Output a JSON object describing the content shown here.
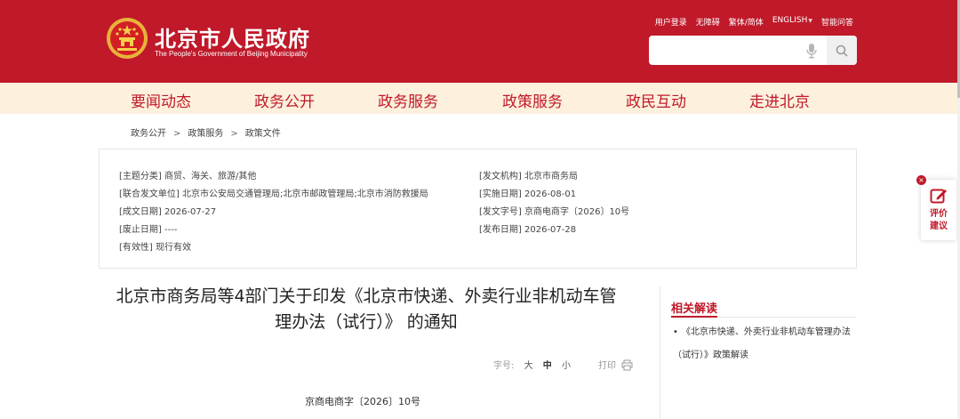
{
  "header": {
    "title": "北京市人民政府",
    "subtitle": "The People's Government of Beijing Municipality",
    "top_links": [
      "用户登录",
      "无障碍",
      "繁体/简体",
      "ENGLISH",
      "智能问答"
    ],
    "search": {
      "value": "",
      "placeholder": ""
    }
  },
  "nav": {
    "items": [
      "要闻动态",
      "政务公开",
      "政务服务",
      "政策服务",
      "政民互动",
      "走进北京"
    ]
  },
  "breadcrumb": [
    "政务公开",
    "政策服务",
    "政策文件"
  ],
  "info": {
    "left": [
      {
        "label": "[主题分类]",
        "value": "商贸、海关、旅游/其他"
      },
      {
        "label": "[联合发文单位]",
        "value": "北京市公安局交通管理局;北京市邮政管理局;北京市消防救援局"
      },
      {
        "label": "[成文日期]",
        "value": "2026-07-27"
      },
      {
        "label": "[废止日期]",
        "value": "----"
      },
      {
        "label": "[有效性]",
        "value": "现行有效"
      }
    ],
    "right": [
      {
        "label": "[发文机构]",
        "value": "北京市商务局"
      },
      {
        "label": "[实施日期]",
        "value": "2026-08-01"
      },
      {
        "label": "[发文字号]",
        "value": "京商电商字〔2026〕10号"
      },
      {
        "label": "[发布日期]",
        "value": "2026-07-28"
      }
    ]
  },
  "article": {
    "title_line1": "北京市商务局等4部门关于印发《北京市快递、外卖行业非机动车管",
    "title_line2": "理办法（试行）》 的通知",
    "font_size_label": "字号:",
    "font_sizes": [
      "大",
      "中",
      "小"
    ],
    "active_font_size": "中",
    "print_label": "打印",
    "doc_number": "京商电商字〔2026〕10号"
  },
  "sidebar": {
    "related_title": "相关解读",
    "related_items": [
      "《北京市快递、外卖行业非机动车管理办法（试行）》政策解读"
    ]
  },
  "feedback": {
    "label_line1": "评价",
    "label_line2": "建议",
    "close": "×"
  },
  "colors": {
    "brand_red": "#c0192a",
    "nav_bg": "#fdf1dd"
  },
  "icons": [
    "national-emblem-icon",
    "microphone-icon",
    "search-icon",
    "print-icon",
    "edit-icon",
    "close-icon"
  ]
}
